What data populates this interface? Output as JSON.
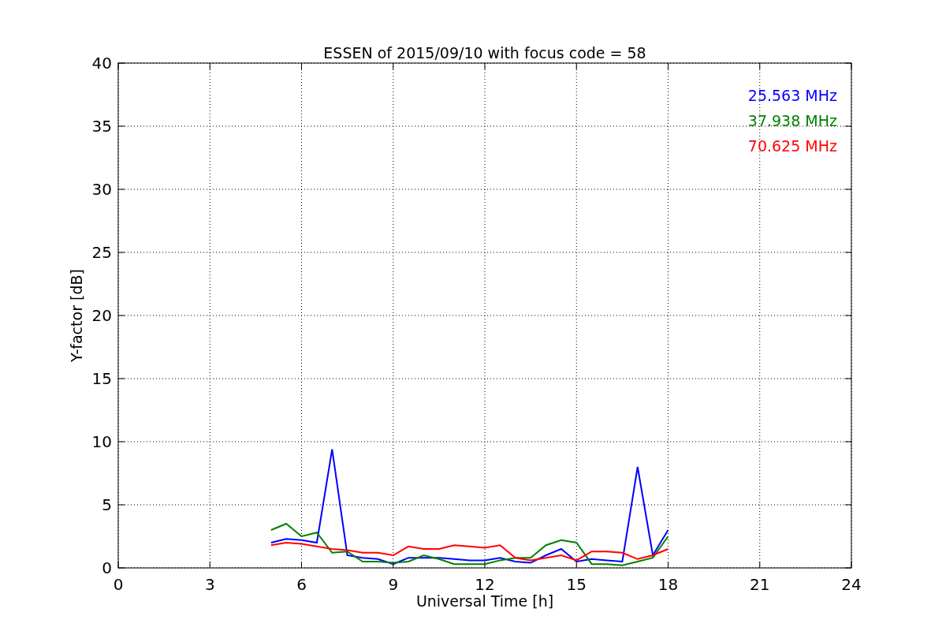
{
  "chart_data": {
    "type": "line",
    "title": "ESSEN of 2015/09/10 with focus code = 58",
    "xlabel": "Universal Time [h]",
    "ylabel": "Y-factor [dB]",
    "x": [
      5,
      5.5,
      6,
      6.5,
      7,
      7.5,
      8,
      8.5,
      9,
      9.5,
      10,
      10.5,
      11,
      11.5,
      12,
      12.5,
      13,
      13.5,
      14,
      14.5,
      15,
      15.5,
      16,
      16.5,
      17,
      17.5,
      18
    ],
    "series": [
      {
        "name": "25.563 MHz",
        "color": "#0000ff",
        "values": [
          2,
          2.3,
          2.2,
          2,
          9.4,
          1,
          0.8,
          0.7,
          0.3,
          0.8,
          0.8,
          0.8,
          0.7,
          0.6,
          0.6,
          0.8,
          0.5,
          0.4,
          1,
          1.5,
          0.5,
          0.7,
          0.6,
          0.5,
          8,
          1,
          3
        ]
      },
      {
        "name": "37.938 MHz",
        "color": "#008000",
        "values": [
          3,
          3.5,
          2.5,
          2.8,
          1.2,
          1.3,
          0.5,
          0.5,
          0.4,
          0.5,
          1,
          0.7,
          0.3,
          0.3,
          0.3,
          0.6,
          0.8,
          0.8,
          1.8,
          2.2,
          2,
          0.3,
          0.3,
          0.2,
          0.5,
          0.8,
          2.5
        ]
      },
      {
        "name": "70.625 MHz",
        "color": "#ff0000",
        "values": [
          1.8,
          2,
          1.9,
          1.7,
          1.5,
          1.4,
          1.2,
          1.2,
          1,
          1.7,
          1.5,
          1.5,
          1.8,
          1.7,
          1.6,
          1.8,
          0.8,
          0.6,
          0.8,
          1,
          0.6,
          1.3,
          1.3,
          1.2,
          0.7,
          1,
          1.5
        ]
      }
    ],
    "xlim": [
      0,
      24
    ],
    "ylim": [
      0,
      40
    ],
    "xticks": [
      0,
      3,
      6,
      9,
      12,
      15,
      18,
      21,
      24
    ],
    "yticks": [
      0,
      5,
      10,
      15,
      20,
      25,
      30,
      35,
      40
    ],
    "grid": true
  }
}
